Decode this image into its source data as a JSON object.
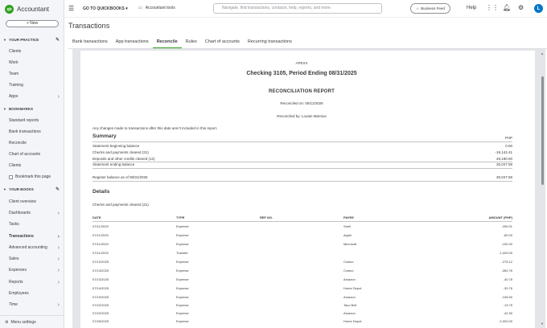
{
  "app": {
    "brand": "Accountant",
    "new_button": "+ New"
  },
  "sidebar": {
    "sections": [
      {
        "label": "YOUR PRACTICE"
      },
      {
        "label": "BOOKMARKS"
      },
      {
        "label": "YOUR BOOKS"
      }
    ],
    "practice_items": [
      "Clients",
      "Work",
      "Team",
      "Training",
      "Apps"
    ],
    "bookmark_items": [
      "Standard reports",
      "Bank transactions",
      "Reconcile",
      "Chart of accounts",
      "Clients",
      "Bookmark this page"
    ],
    "book_items": [
      "Client overview",
      "Dashboards",
      "Tasks",
      "Transactions",
      "Advanced accounting",
      "Sales",
      "Expenses",
      "Reports",
      "Employees",
      "Time"
    ],
    "menu_settings": "Menu settings"
  },
  "topbar": {
    "goto": "GO TO QUICKBOOKS",
    "tools": "Accountant tools",
    "search_placeholder": "Navigate, find transactions, contacts, help, reports, and more",
    "business_feed": "Business Feed",
    "help": "Help",
    "avatar": "L"
  },
  "page": {
    "title": "Transactions",
    "tabs": [
      "Bank transactions",
      "App transactions",
      "Reconcile",
      "Rules",
      "Chart of accounts",
      "Recurring transactions"
    ],
    "active_tab": "Reconcile"
  },
  "report": {
    "company": "APEXX",
    "title": "Checking 3105, Period Ending 08/31/2025",
    "subtitle": "RECONCILIATION REPORT",
    "reconciled_on": "Reconciled on: 05/11/2026",
    "reconciled_by": "Reconciled by: Louian Marnius",
    "note": "Any changes made to transactions after this date aren't included in this report.",
    "summary_heading": "Summary",
    "currency": "PHP",
    "summary_rows": [
      {
        "label": "Statement beginning balance",
        "value": "0.00"
      },
      {
        "label": "Checks and payments cleared (31)",
        "value": "-19,142.41"
      },
      {
        "label": "Deposits and other credits cleared (12)",
        "value": "49,190.00"
      },
      {
        "label": "Statement ending balance",
        "value": "30,047.59"
      }
    ],
    "register_balance": {
      "label": "Register balance as of 08/31/2025",
      "value": "30,047.59"
    },
    "details_heading": "Details",
    "details_sub": "Checks and payments cleared (31)",
    "columns": [
      "DATE",
      "TYPE",
      "REF NO.",
      "PAYEE",
      "AMOUNT (PHP)"
    ],
    "rows": [
      {
        "date": "07/11/2025",
        "type": "Expense",
        "ref": "",
        "payee": "Shell",
        "amount": "-250.01"
      },
      {
        "date": "07/11/2025",
        "type": "Expense",
        "ref": "",
        "payee": "Apple",
        "amount": "-80.00"
      },
      {
        "date": "07/11/2025",
        "type": "Expense",
        "ref": "",
        "payee": "Microsoft",
        "amount": "-150.00"
      },
      {
        "date": "07/11/2025",
        "type": "Transfer",
        "ref": "",
        "payee": "",
        "amount": "-1,000.00"
      },
      {
        "date": "07/12/2025",
        "type": "Expense",
        "ref": "",
        "payee": "Costco",
        "amount": "-275.12"
      },
      {
        "date": "07/13/2025",
        "type": "Expense",
        "ref": "",
        "payee": "Costco",
        "amount": "-350.76"
      },
      {
        "date": "07/13/2025",
        "type": "Expense",
        "ref": "",
        "payee": "Amazon",
        "amount": "-40.78"
      },
      {
        "date": "07/14/2025",
        "type": "Expense",
        "ref": "",
        "payee": "Home Depot",
        "amount": "-30.76"
      },
      {
        "date": "07/19/2025",
        "type": "Expense",
        "ref": "",
        "payee": "Amazon",
        "amount": "-105.50"
      },
      {
        "date": "07/22/2025",
        "type": "Expense",
        "ref": "",
        "payee": "Taco Bell",
        "amount": "-13.75"
      },
      {
        "date": "07/22/2025",
        "type": "Expense",
        "ref": "",
        "payee": "Amazon",
        "amount": "-42.59"
      },
      {
        "date": "07/26/2025",
        "type": "Expense",
        "ref": "",
        "payee": "Home Depot",
        "amount": "-2,000.00"
      }
    ]
  }
}
